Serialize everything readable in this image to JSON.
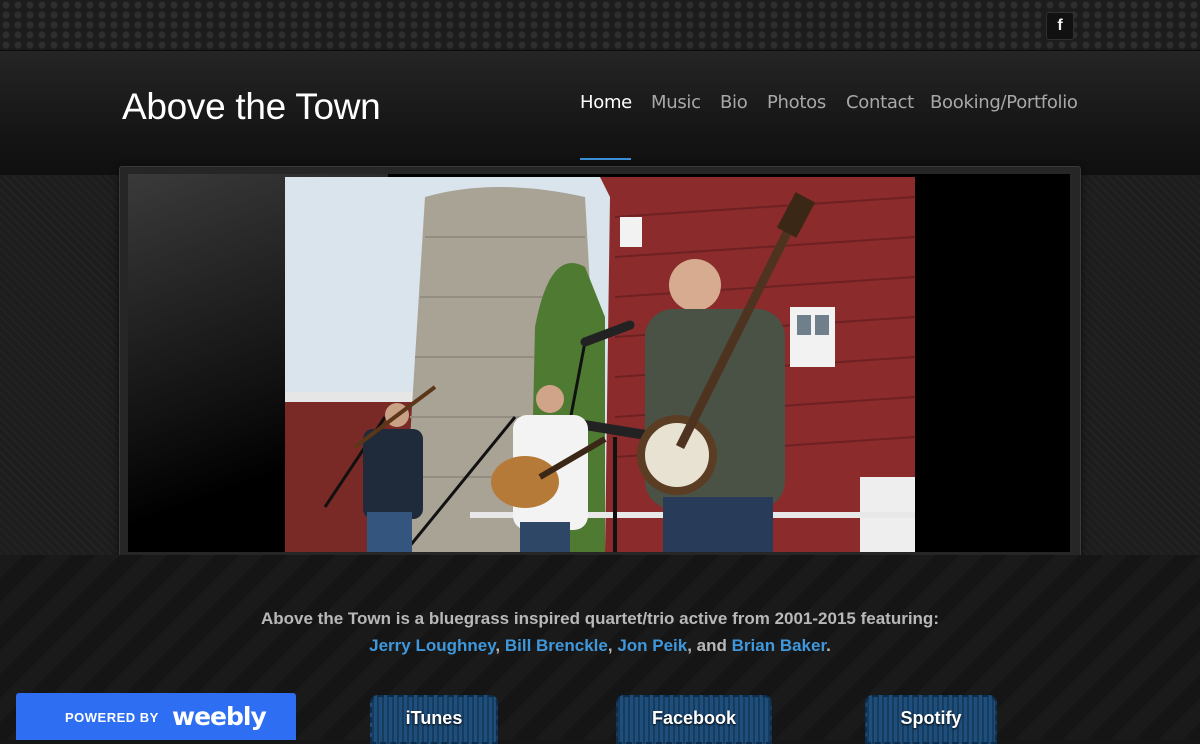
{
  "site": {
    "title": "Above the Town"
  },
  "social": {
    "facebook_glyph": "f",
    "facebook_icon": "facebook-icon"
  },
  "nav": {
    "items": [
      {
        "label": "Home",
        "active": true
      },
      {
        "label": "Music",
        "active": false
      },
      {
        "label": "Bio",
        "active": false
      },
      {
        "label": "Photos",
        "active": false
      },
      {
        "label": "Contact",
        "active": false
      },
      {
        "label": "Booking/Portfolio",
        "active": false
      }
    ],
    "active_color": "#ffffff",
    "underline_color": "#3a8fd6"
  },
  "intro": {
    "line1": "Above the Town is a bluegrass inspired quartet/trio active from 2001-2015 featuring:",
    "members": [
      "Jerry Loughney",
      "Bill Brenckle",
      "Jon Peik",
      "Brian Baker"
    ],
    "sep1": ", ",
    "sep2": ", ",
    "sep3": ", and ",
    "end": ".",
    "link_color": "#3f97dc"
  },
  "buttons": {
    "itunes": "iTunes",
    "facebook": "Facebook",
    "spotify": "Spotify"
  },
  "footer": {
    "powered_by": "POWERED BY",
    "brand": "weebly",
    "brand_color": "#2e6ef2"
  }
}
